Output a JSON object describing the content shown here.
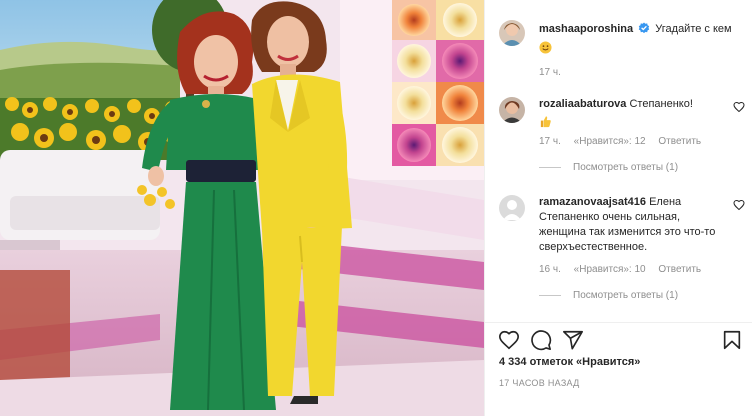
{
  "post": {
    "author": "mashaaporoshina",
    "caption": "Угадайте с кем",
    "caption_emoji": "smiling-face",
    "time": "17 ч."
  },
  "comments": [
    {
      "user": "rozaliaabaturova",
      "text": "Степаненко!",
      "emoji": "thumbs-up",
      "time": "17 ч.",
      "likes": "«Нравится»: 12",
      "reply_label": "Ответить",
      "view_replies": "Посмотреть ответы (1)"
    },
    {
      "user": "ramazanovaajsat416",
      "text": "Елена Степаненко очень сильная, женщина так изменится это что-то сверхъестественное.",
      "time": "16 ч.",
      "likes": "«Нравится»: 10",
      "reply_label": "Ответить",
      "view_replies": "Посмотреть ответы (1)"
    }
  ],
  "footer": {
    "likes_count": "4 334 отметок «Нравится»",
    "posted_ago": "17 ЧАСОВ НАЗАД"
  },
  "icons": {
    "like": "heart-icon",
    "comment": "comment-icon",
    "share": "paper-plane-icon",
    "save": "bookmark-icon",
    "verified": "verified-badge-icon"
  },
  "colors": {
    "verified": "#3897f0",
    "text": "#262626",
    "muted": "#8e8e8e",
    "green_dress": "#1f8a4c",
    "yellow_suit": "#f2d72e"
  }
}
